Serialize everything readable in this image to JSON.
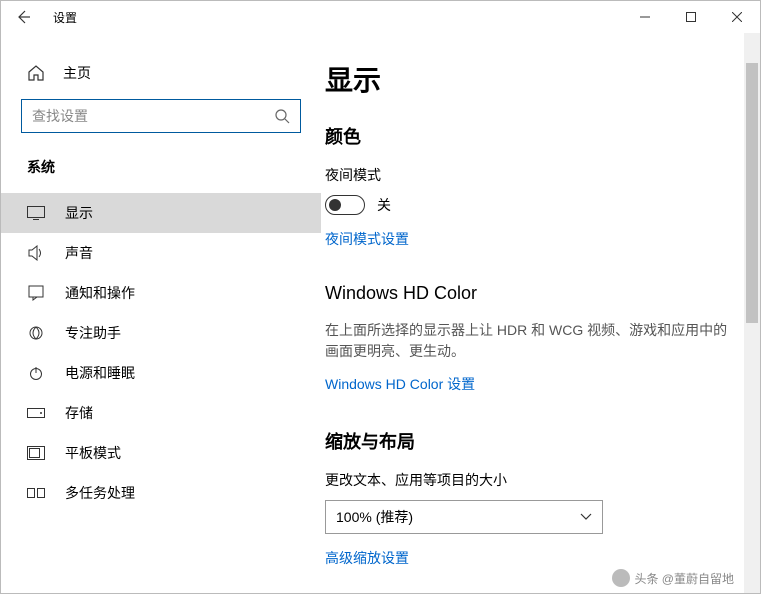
{
  "window": {
    "title": "设置"
  },
  "sidebar": {
    "home": "主页",
    "search_placeholder": "查找设置",
    "section": "系统",
    "items": [
      {
        "label": "显示",
        "selected": true
      },
      {
        "label": "声音",
        "selected": false
      },
      {
        "label": "通知和操作",
        "selected": false
      },
      {
        "label": "专注助手",
        "selected": false
      },
      {
        "label": "电源和睡眠",
        "selected": false
      },
      {
        "label": "存储",
        "selected": false
      },
      {
        "label": "平板模式",
        "selected": false
      },
      {
        "label": "多任务处理",
        "selected": false
      }
    ]
  },
  "main": {
    "page_title": "显示",
    "color_section": "颜色",
    "night_label": "夜间模式",
    "night_state": "关",
    "night_link": "夜间模式设置",
    "hd_title": "Windows HD Color",
    "hd_desc": "在上面所选择的显示器上让 HDR 和 WCG 视频、游戏和应用中的画面更明亮、更生动。",
    "hd_link": "Windows HD Color 设置",
    "scale_title": "缩放与布局",
    "scale_label": "更改文本、应用等项目的大小",
    "scale_value": "100% (推荐)",
    "scale_link": "高级缩放设置"
  },
  "watermark": "头条 @董蔚自留地"
}
